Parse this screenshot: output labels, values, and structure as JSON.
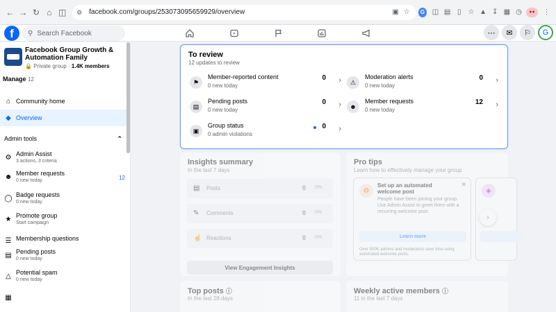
{
  "browser": {
    "url": "facebook.com/groups/253073095659929/overview"
  },
  "fb": {
    "search_placeholder": "Search Facebook",
    "logo": "f"
  },
  "group": {
    "name": "Facebook Group Growth & Automation Family",
    "privacy": "Private group",
    "members": "1.4K members"
  },
  "sidebar": {
    "manage_label": "Manage",
    "manage_count": "12",
    "community_home": "Community home",
    "overview": "Overview",
    "admin_tools": "Admin tools",
    "admin_items": [
      {
        "title": "Admin Assist",
        "sub": "3 actions, 3 criteria",
        "badge": ""
      },
      {
        "title": "Member requests",
        "sub": "0 new today",
        "badge": "12"
      },
      {
        "title": "Badge requests",
        "sub": "0 new today",
        "badge": ""
      },
      {
        "title": "Promote group",
        "sub": "Start campaign",
        "badge": ""
      },
      {
        "title": "Membership questions",
        "sub": "",
        "badge": ""
      },
      {
        "title": "Pending posts",
        "sub": "0 new today",
        "badge": ""
      },
      {
        "title": "Potential spam",
        "sub": "0 new today",
        "badge": ""
      }
    ]
  },
  "review": {
    "title": "To review",
    "subtitle": "12 updates to review",
    "items": [
      {
        "title": "Member-reported content",
        "sub": "0 new today",
        "count": "0"
      },
      {
        "title": "Moderation alerts",
        "sub": "0 new today",
        "count": "0"
      },
      {
        "title": "Pending posts",
        "sub": "0 new today",
        "count": "0"
      },
      {
        "title": "Member requests",
        "sub": "0 new today",
        "count": "12"
      },
      {
        "title": "Group status",
        "sub": "0 admin violations",
        "count": "0"
      }
    ]
  },
  "insights": {
    "title": "Insights summary",
    "subtitle": "In the last 7 days",
    "rows": [
      {
        "label": "Posts",
        "value": "0",
        "pct": "0%"
      },
      {
        "label": "Comments",
        "value": "0",
        "pct": "0%"
      },
      {
        "label": "Reactions",
        "value": "0",
        "pct": "0%"
      }
    ],
    "button": "View Engagement Insights"
  },
  "tips": {
    "title": "Pro tips",
    "subtitle": "Learn how to effectively manage your group",
    "tip_title": "Set up an automated welcome post",
    "tip_desc": "People have been joining your group. Use Admin Assist to greet them with a recurring welcome post.",
    "tip_button": "Learn more",
    "tip_footer": "Over 500K admins and moderators save time using automated welcome posts."
  },
  "top_posts": {
    "title": "Top posts",
    "subtitle": "In the last 28 days"
  },
  "weekly": {
    "title": "Weekly active members",
    "subtitle": "11 in the last 7 days"
  }
}
